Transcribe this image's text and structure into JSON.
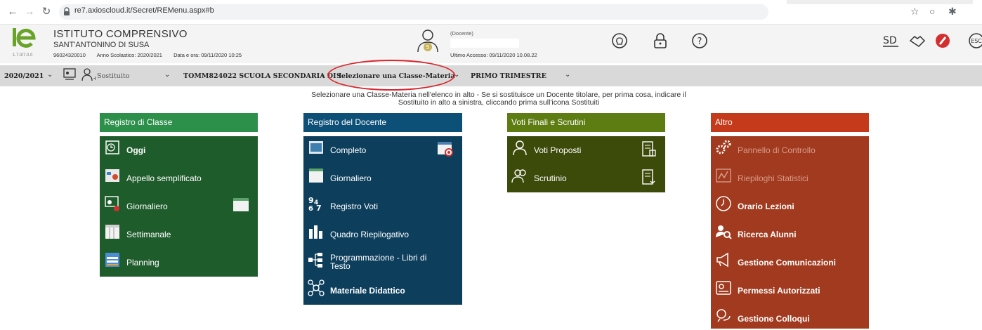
{
  "browser": {
    "url": "re7.axioscloud.it/Secret/REMenu.aspx#b"
  },
  "header": {
    "logo_version": "1.7.0/7.0.0",
    "school_name": "ISTITUTO COMPRENSIVO",
    "school_town": "SANT'ANTONINO DI SUSA",
    "school_code": "96024320010",
    "school_year": "Anno Scolastico: 2020/2021",
    "datetime": "Data e ora: 09/11/2020 10:25",
    "user_role": "(Docente)",
    "last_access": "Ultimo Accesso: 09/11/2020 10.08.22"
  },
  "toolbar": {
    "year": "2020/2021",
    "substitute": "Sostituito",
    "school_select": "TOMM824022 SCUOLA SECONDARIA DI I",
    "class_select": "Selezionare una Classe-Materia",
    "term": "PRIMO TRIMESTRE"
  },
  "instructions": {
    "line1": "Selezionare una Classe-Materia nell'elenco in alto - Se si sostituisce un Docente titolare, per prima cosa, indicare il",
    "line2": "Sostituito in alto a sinistra, cliccando prima sull'icona Sostituiti"
  },
  "panels": {
    "registro_classe": {
      "title": "Registro di Classe",
      "items": [
        "Oggi",
        "Appello semplificato",
        "Giornaliero",
        "Settimanale",
        "Planning"
      ]
    },
    "registro_docente": {
      "title": "Registro del Docente",
      "items": [
        "Completo",
        "Giornaliero",
        "Registro Voti",
        "Quadro Riepilogativo",
        "Programmazione - Libri di Testo",
        "Materiale Didattico"
      ]
    },
    "voti_finali": {
      "title": "Voti Finali e Scrutini",
      "items": [
        "Voti Proposti",
        "Scrutinio"
      ]
    },
    "altro": {
      "title": "Altro",
      "items": [
        "Pannello di Controllo",
        "Riepiloghi Statistici",
        "Orario Lezioni",
        "Ricerca Alunni",
        "Gestione Comunicazioni",
        "Permessi Autorizzati",
        "Gestione Colloqui"
      ]
    }
  },
  "colors": {
    "registro_classe_head": "#2c8f4a",
    "registro_classe_body": "#1f5c2c",
    "registro_docente_head": "#0c4f77",
    "registro_docente_body": "#0d3f5d",
    "voti_head": "#5d7c12",
    "voti_body": "#3c4a0a",
    "altro_head": "#c53a1a",
    "altro_body": "#a13a1e",
    "highlight": "#d9262e"
  }
}
